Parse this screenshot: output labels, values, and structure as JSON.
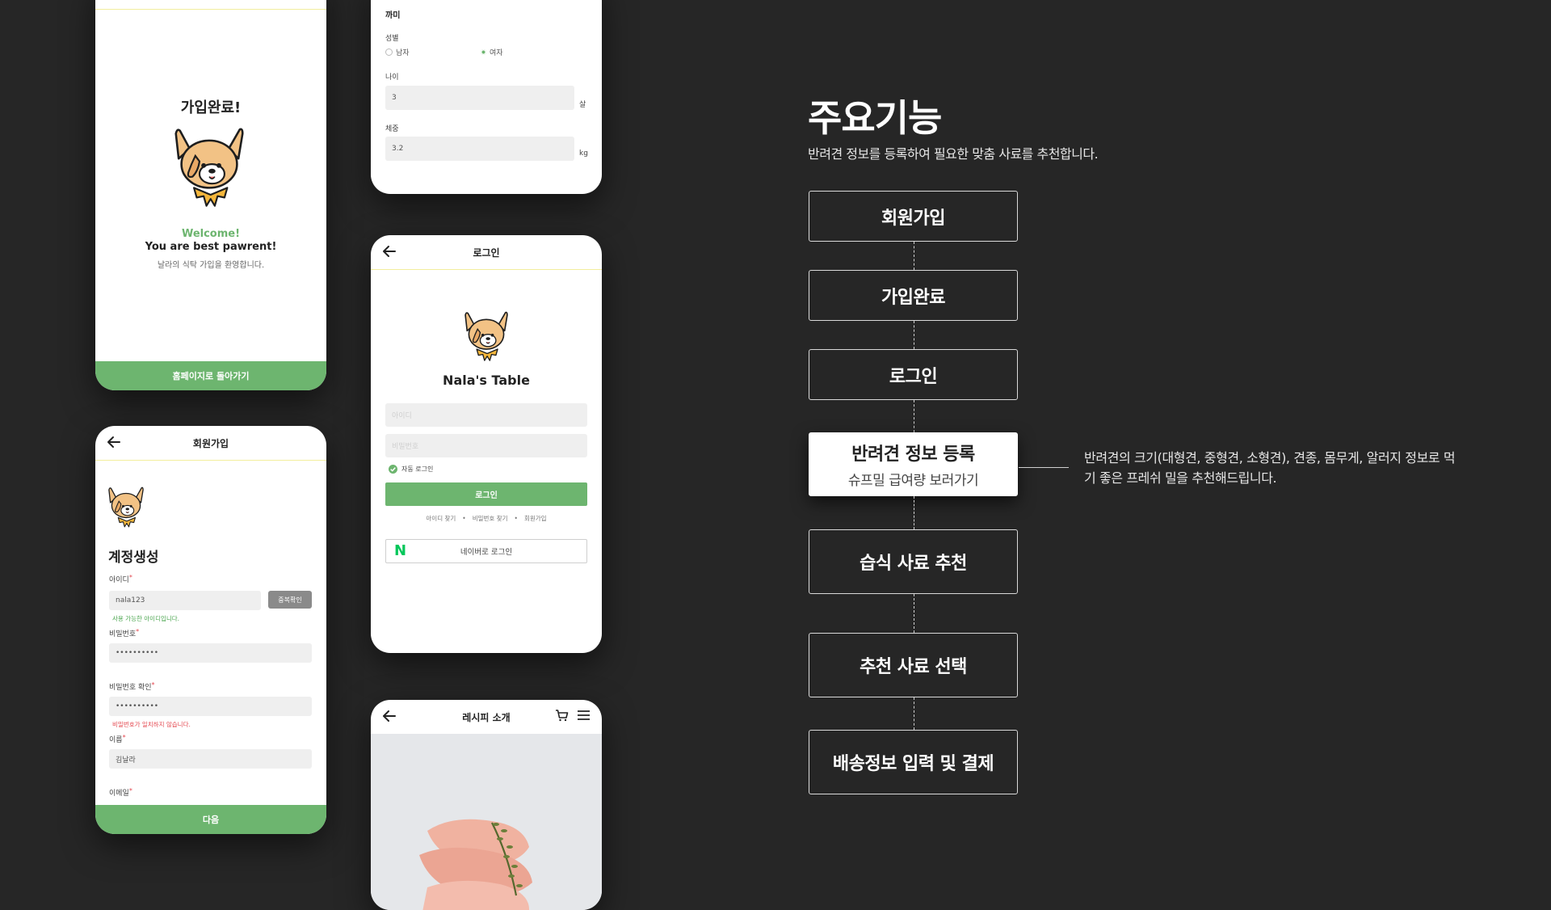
{
  "screens": {
    "signup_complete": {
      "title": "가입완료!",
      "welcome": "Welcome!",
      "tagline": "You are best pawrent!",
      "message": "날라의 식탁 가입을 환영합니다.",
      "button": "홈페이지로 돌아가기"
    },
    "pet_info": {
      "name_value": "까미",
      "gender_label": "성별",
      "gender_options": [
        "남자",
        "여자"
      ],
      "gender_selected": "여자",
      "age_label": "나이",
      "age_value": "3",
      "age_unit": "살",
      "weight_label": "체중",
      "weight_value": "3.2",
      "weight_unit": "kg"
    },
    "signup": {
      "title": "회원가입",
      "heading": "계정생성",
      "id_label": "아이디",
      "id_value": "nala123",
      "dup_check": "중복확인",
      "id_ok": "사용 가능한 아이디입니다.",
      "pw_label": "비밀번호",
      "pw_value": "••••••••••",
      "pw_confirm_label": "비밀번호 확인",
      "pw_confirm_value": "••••••••••",
      "pw_error": "비밀번호가 일치하지 않습니다.",
      "name_label": "이름",
      "name_value": "김날라",
      "email_label": "이메일",
      "button": "다음"
    },
    "login": {
      "title": "로그인",
      "brand": "Nala's Table",
      "id_placeholder": "아이디",
      "pw_placeholder": "비밀번호",
      "auto_login": "자동 로그인",
      "button": "로그인",
      "links": [
        "아이디 찾기",
        "비밀번호 찾기",
        "회원가입"
      ],
      "naver_letter": "N",
      "naver": "네이버로 로그인"
    },
    "recipe": {
      "title": "레시피 소개"
    }
  },
  "flow": {
    "title": "주요기능",
    "subtitle": "반려견 정보를 등록하여 필요한 맞춤 사료를 추천합니다.",
    "steps": [
      {
        "label": "회원가입"
      },
      {
        "label": "가입완료"
      },
      {
        "label": "로그인"
      },
      {
        "label": "반려견 정보 등록",
        "sub": "슈프밀 급여량 보러가기"
      },
      {
        "label": "습식 사료 추천"
      },
      {
        "label": "추천 사료 선택"
      },
      {
        "label": "배송정보 입력 및 결제"
      }
    ],
    "note": "반려견의 크기(대형견, 중형견, 소형견), 견종, 몸무게, 알러지 정보로 먹기 좋은 프레쉬 밀을 추천해드립니다."
  },
  "colors": {
    "background": "#262626",
    "accent_green": "#6db56f",
    "divider_yellow": "#f2ee9d",
    "error_red": "#e4474f",
    "naver_green": "#03c75a"
  }
}
